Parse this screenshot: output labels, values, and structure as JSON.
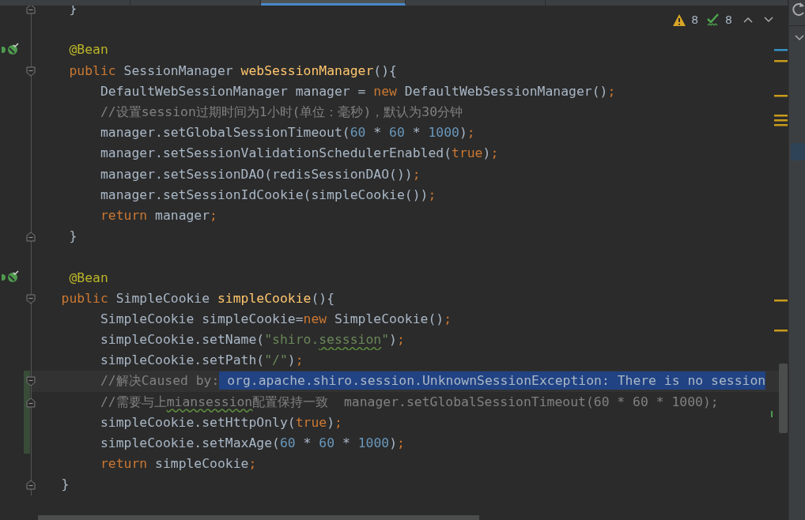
{
  "tabs": [
    {
      "selected": false
    },
    {
      "selected": false
    },
    {
      "selected": true
    },
    {
      "selected": false
    },
    {
      "selected": false
    }
  ],
  "inspections": {
    "warnings": "8",
    "weak_warnings": "8"
  },
  "lines": [
    {
      "kind": "code",
      "fold_end": true,
      "tokens": [
        {
          "kind": "plain",
          "text": "    }"
        }
      ]
    },
    {
      "kind": "blank"
    },
    {
      "kind": "code",
      "bean_marker": true,
      "tokens": [
        {
          "kind": "annotation",
          "text": "    @Bean"
        }
      ]
    },
    {
      "kind": "code",
      "fold_start": true,
      "tokens": [
        {
          "kind": "keyword",
          "text": "    public "
        },
        {
          "kind": "plain",
          "text": "SessionManager "
        },
        {
          "kind": "method",
          "text": "webSessionManager"
        },
        {
          "kind": "plain",
          "text": "(){"
        }
      ]
    },
    {
      "kind": "code",
      "tokens": [
        {
          "kind": "plain",
          "text": "        DefaultWebSessionManager manager = "
        },
        {
          "kind": "keyword",
          "text": "new "
        },
        {
          "kind": "plain",
          "text": "DefaultWebSessionManager()"
        },
        {
          "kind": "keyword",
          "text": ";"
        }
      ]
    },
    {
      "kind": "code",
      "tokens": [
        {
          "kind": "comment",
          "text": "        //设置session过期时间为1小时(单位：毫秒)，默认为30分钟"
        }
      ]
    },
    {
      "kind": "code",
      "tokens": [
        {
          "kind": "plain",
          "text": "        manager.setGlobalSessionTimeout("
        },
        {
          "kind": "number",
          "text": "60"
        },
        {
          "kind": "plain",
          "text": " * "
        },
        {
          "kind": "number",
          "text": "60"
        },
        {
          "kind": "plain",
          "text": " * "
        },
        {
          "kind": "number",
          "text": "1000"
        },
        {
          "kind": "plain",
          "text": ")"
        },
        {
          "kind": "keyword",
          "text": ";"
        }
      ]
    },
    {
      "kind": "code",
      "tokens": [
        {
          "kind": "plain",
          "text": "        manager.setSessionValidationSchedulerEnabled("
        },
        {
          "kind": "keyword",
          "text": "true"
        },
        {
          "kind": "plain",
          "text": ")"
        },
        {
          "kind": "keyword",
          "text": ";"
        }
      ]
    },
    {
      "kind": "code",
      "tokens": [
        {
          "kind": "plain",
          "text": "        manager.setSessionDAO(redisSessionDAO())"
        },
        {
          "kind": "keyword",
          "text": ";"
        }
      ]
    },
    {
      "kind": "code",
      "tokens": [
        {
          "kind": "plain",
          "text": "        manager.setSessionIdCookie(simpleCookie())"
        },
        {
          "kind": "keyword",
          "text": ";"
        }
      ]
    },
    {
      "kind": "code",
      "tokens": [
        {
          "kind": "keyword",
          "text": "        return "
        },
        {
          "kind": "plain",
          "text": "manager"
        },
        {
          "kind": "keyword",
          "text": ";"
        }
      ]
    },
    {
      "kind": "code",
      "fold_end": true,
      "tokens": [
        {
          "kind": "plain",
          "text": "    }"
        }
      ]
    },
    {
      "kind": "blank"
    },
    {
      "kind": "code",
      "bean_marker": true,
      "tokens": [
        {
          "kind": "annotation",
          "text": "    @Bean"
        }
      ]
    },
    {
      "kind": "code",
      "fold_start": true,
      "tokens": [
        {
          "kind": "keyword",
          "text": "   public "
        },
        {
          "kind": "plain",
          "text": "SimpleCookie "
        },
        {
          "kind": "method",
          "text": "simpleCookie"
        },
        {
          "kind": "plain",
          "text": "(){"
        }
      ]
    },
    {
      "kind": "code",
      "tokens": [
        {
          "kind": "plain",
          "text": "        SimpleCookie simpleCookie="
        },
        {
          "kind": "keyword",
          "text": "new "
        },
        {
          "kind": "plain",
          "text": "SimpleCookie()"
        },
        {
          "kind": "keyword",
          "text": ";"
        }
      ]
    },
    {
      "kind": "code",
      "tokens": [
        {
          "kind": "plain",
          "text": "        simpleCookie.setName("
        },
        {
          "kind": "string",
          "text": "\"shiro."
        },
        {
          "kind": "string_typo",
          "text": "sesssion"
        },
        {
          "kind": "string",
          "text": "\""
        },
        {
          "kind": "plain",
          "text": ")"
        },
        {
          "kind": "keyword",
          "text": ";"
        }
      ]
    },
    {
      "kind": "code",
      "tokens": [
        {
          "kind": "plain",
          "text": "        simpleCookie.setPath("
        },
        {
          "kind": "string",
          "text": "\"/\""
        },
        {
          "kind": "plain",
          "text": ")"
        },
        {
          "kind": "keyword",
          "text": ";"
        }
      ]
    },
    {
      "kind": "code",
      "fold_start": true,
      "changed": true,
      "current": true,
      "caret": true,
      "tokens": [
        {
          "kind": "comment",
          "text": "        //解决Caused by:"
        },
        {
          "kind": "selection",
          "text": " org.apache.shiro.session.UnknownSessionException: There is no session"
        }
      ]
    },
    {
      "kind": "code",
      "fold_end": true,
      "changed": true,
      "tokens": [
        {
          "kind": "comment",
          "text": "        //需要与上"
        },
        {
          "kind": "comment_typo",
          "text": "miansession"
        },
        {
          "kind": "comment",
          "text": "配置保持一致  manager.setGlobalSessionTimeout(60 * 60 * 1000);"
        }
      ]
    },
    {
      "kind": "code",
      "changed": true,
      "tokens": [
        {
          "kind": "plain",
          "text": "        simpleCookie.setHttpOnly("
        },
        {
          "kind": "keyword",
          "text": "true"
        },
        {
          "kind": "plain",
          "text": ")"
        },
        {
          "kind": "keyword",
          "text": ";"
        }
      ]
    },
    {
      "kind": "code",
      "changed": true,
      "tokens": [
        {
          "kind": "plain",
          "text": "        simpleCookie.setMaxAge("
        },
        {
          "kind": "number",
          "text": "60"
        },
        {
          "kind": "plain",
          "text": " * "
        },
        {
          "kind": "number",
          "text": "60"
        },
        {
          "kind": "plain",
          "text": " * "
        },
        {
          "kind": "number",
          "text": "1000"
        },
        {
          "kind": "plain",
          "text": ")"
        },
        {
          "kind": "keyword",
          "text": ";"
        }
      ]
    },
    {
      "kind": "code",
      "tokens": [
        {
          "kind": "keyword",
          "text": "        return "
        },
        {
          "kind": "plain",
          "text": "simpleCookie"
        },
        {
          "kind": "keyword",
          "text": ";"
        }
      ]
    },
    {
      "kind": "code",
      "fold_end": true,
      "tokens": [
        {
          "kind": "plain",
          "text": "   }"
        }
      ]
    }
  ]
}
